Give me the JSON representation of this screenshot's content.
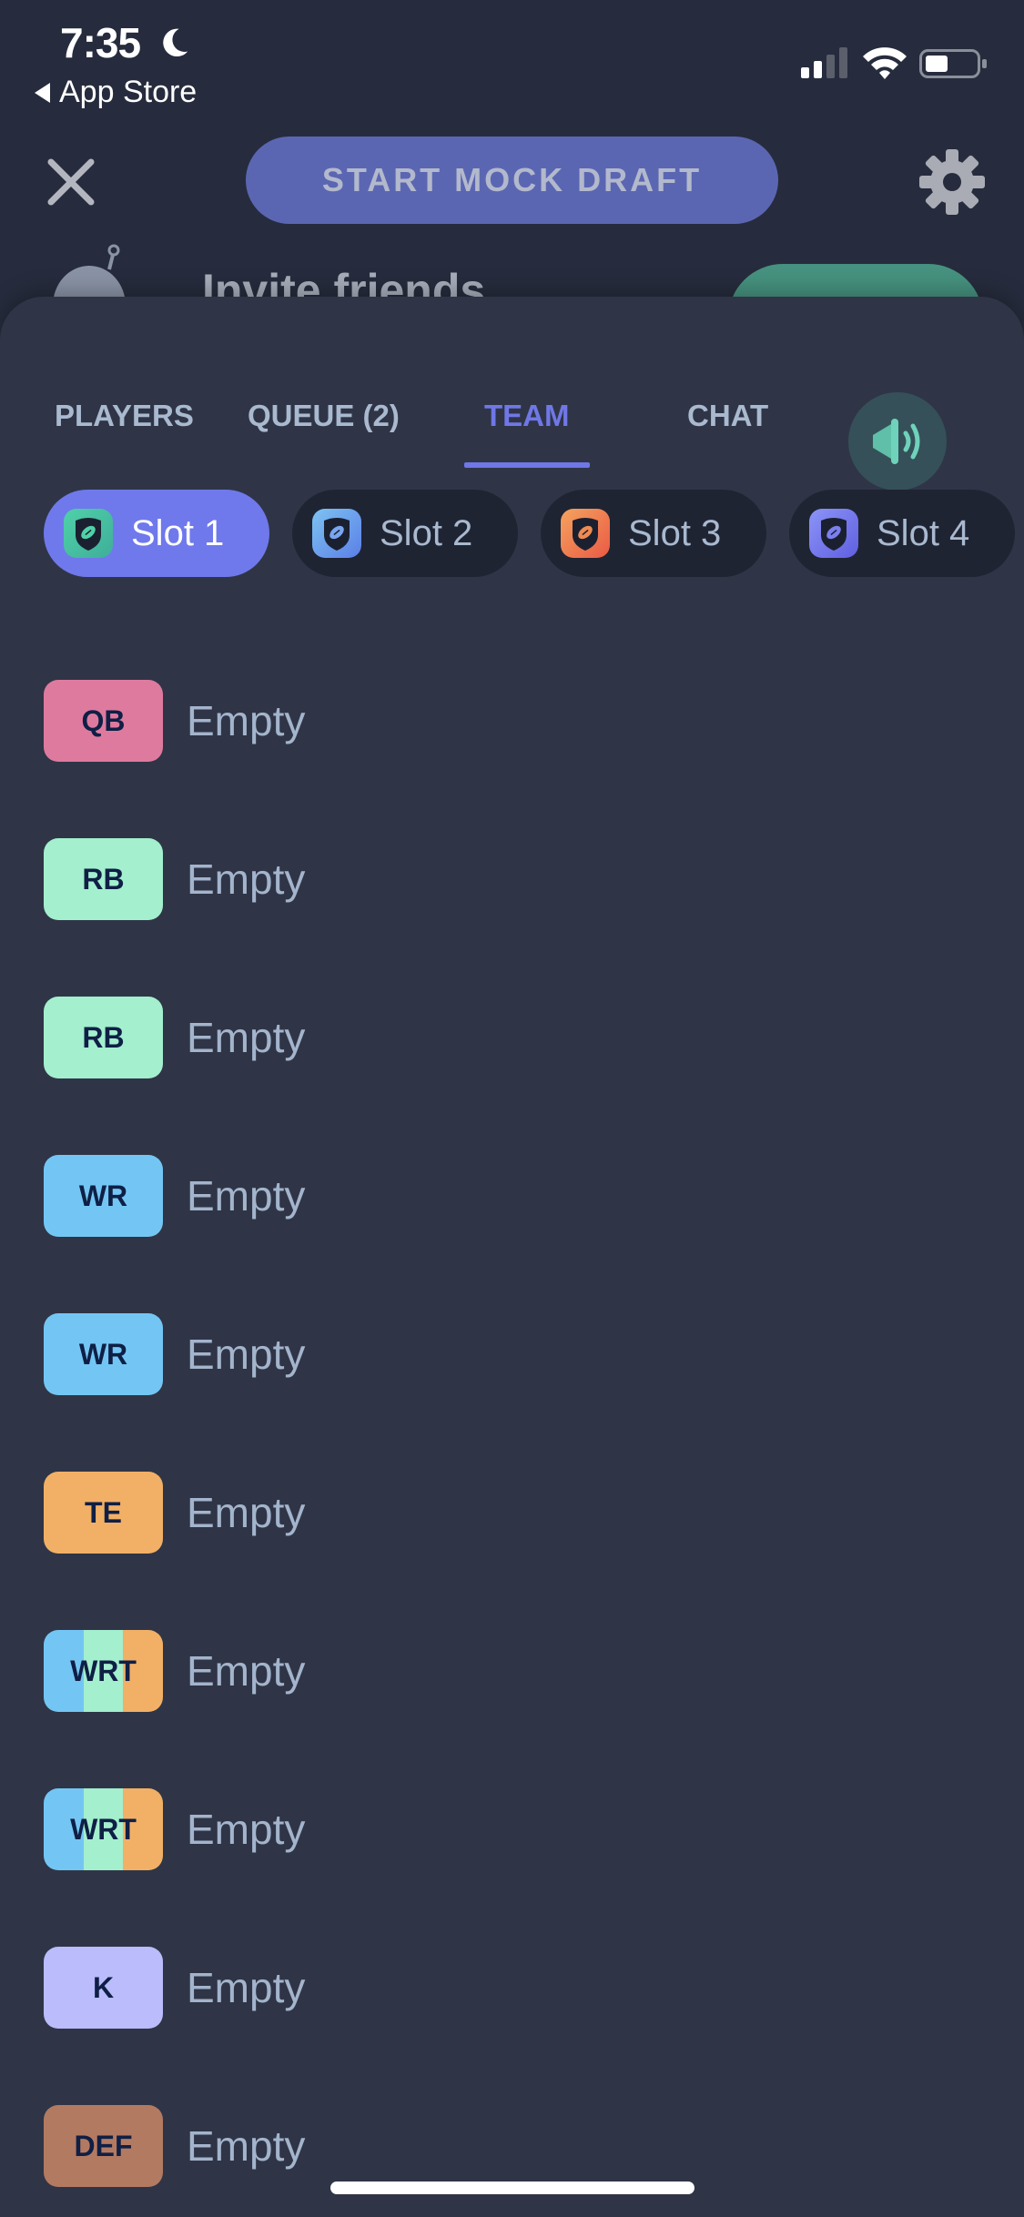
{
  "status_bar": {
    "time": "7:35",
    "back_label": "App Store",
    "focus_icon": "moon-icon",
    "signal_icon": "cellular-signal-icon",
    "wifi_icon": "wifi-icon",
    "battery_icon": "battery-icon"
  },
  "header": {
    "close_icon": "close-icon",
    "start_button_label": "START MOCK DRAFT",
    "settings_icon": "gear-icon",
    "invite_text": "Invite friends",
    "invite_button_color": "#46917f"
  },
  "tabs": [
    {
      "label": "PLAYERS",
      "active": false
    },
    {
      "label": "QUEUE (2)",
      "active": false
    },
    {
      "label": "TEAM",
      "active": true
    },
    {
      "label": "CHAT",
      "active": false
    }
  ],
  "sound_icon": "speaker-icon",
  "accent_color": "#7077e6",
  "slots": [
    {
      "label": "Slot 1",
      "active": true,
      "icon_gradient": [
        "#4fd1a8",
        "#3fae9a"
      ],
      "ball_color": "#4fd1a8"
    },
    {
      "label": "Slot 2",
      "active": false,
      "icon_gradient": [
        "#7dc3f3",
        "#5b7fe6"
      ],
      "ball_color": "#7aa6f0"
    },
    {
      "label": "Slot 3",
      "active": false,
      "icon_gradient": [
        "#f4a35e",
        "#ea5a45"
      ],
      "ball_color": "#f08a52"
    },
    {
      "label": "Slot 4",
      "active": false,
      "icon_gradient": [
        "#8c94f7",
        "#5f5fe0"
      ],
      "ball_color": "#7b7ff0"
    }
  ],
  "roster": [
    {
      "position": "QB",
      "player": "Empty",
      "colors": [
        "#df7a9f"
      ]
    },
    {
      "position": "RB",
      "player": "Empty",
      "colors": [
        "#a3efce"
      ]
    },
    {
      "position": "RB",
      "player": "Empty",
      "colors": [
        "#a3efce"
      ]
    },
    {
      "position": "WR",
      "player": "Empty",
      "colors": [
        "#73c6f4"
      ]
    },
    {
      "position": "WR",
      "player": "Empty",
      "colors": [
        "#73c6f4"
      ]
    },
    {
      "position": "TE",
      "player": "Empty",
      "colors": [
        "#f2b066"
      ]
    },
    {
      "position": "WRT",
      "player": "Empty",
      "colors": [
        "#73c6f4",
        "#a3efce",
        "#f2b066"
      ]
    },
    {
      "position": "WRT",
      "player": "Empty",
      "colors": [
        "#73c6f4",
        "#a3efce",
        "#f2b066"
      ]
    },
    {
      "position": "K",
      "player": "Empty",
      "colors": [
        "#babcfc"
      ]
    },
    {
      "position": "DEF",
      "player": "Empty",
      "colors": [
        "#b37a62"
      ]
    }
  ]
}
